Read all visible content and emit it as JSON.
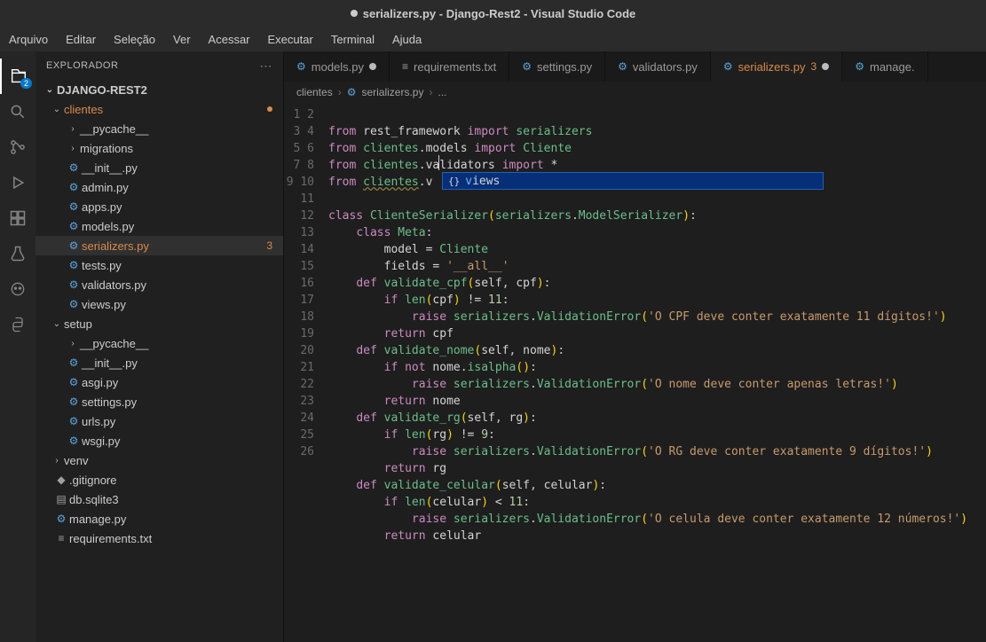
{
  "window": {
    "title": "serializers.py - Django-Rest2 - Visual Studio Code"
  },
  "menu": [
    "Arquivo",
    "Editar",
    "Seleção",
    "Ver",
    "Acessar",
    "Executar",
    "Terminal",
    "Ajuda"
  ],
  "activity": {
    "badge": "2"
  },
  "sidebar": {
    "title": "EXPLORADOR",
    "root": "DJANGO-REST2",
    "clientes": {
      "label": "clientes",
      "badge": "3",
      "children": {
        "pycache": "__pycache__",
        "migrations": "migrations",
        "init": "__init__.py",
        "admin": "admin.py",
        "apps": "apps.py",
        "models": "models.py",
        "serializers": "serializers.py",
        "tests": "tests.py",
        "validators": "validators.py",
        "views": "views.py"
      }
    },
    "setup": {
      "label": "setup",
      "children": {
        "pycache": "__pycache__",
        "init": "__init__.py",
        "asgi": "asgi.py",
        "settings": "settings.py",
        "urls": "urls.py",
        "wsgi": "wsgi.py"
      }
    },
    "venv": "venv",
    "gitignore": ".gitignore",
    "db": "db.sqlite3",
    "manage": "manage.py",
    "reqs": "requirements.txt"
  },
  "tabs": {
    "models": "models.py",
    "reqs": "requirements.txt",
    "settings": "settings.py",
    "validators": "validators.py",
    "serializers": "serializers.py",
    "serializers_badge": "3",
    "manage": "manage."
  },
  "crumbs": {
    "a": "clientes",
    "b": "serializers.py",
    "c": "..."
  },
  "suggest": {
    "icon": "{}",
    "match": "v",
    "rest": "iews"
  },
  "code": {
    "l1": {
      "from": "from",
      "rest": "rest_framework",
      "import": "import",
      "serializers": "serializers"
    },
    "l2": {
      "from": "from",
      "clientes": "clientes",
      "models": "models",
      "import": "import",
      "Cliente": "Cliente"
    },
    "l3": {
      "from": "from",
      "clientes": "clientes",
      "validators": "validators",
      "import": "import",
      "star": "*"
    },
    "l4": {
      "from": "from",
      "clientes": "clientes",
      "v": "v"
    },
    "l6": {
      "class": "class",
      "name": "ClienteSerializer",
      "ser": "serializers",
      "ms": "ModelSerializer"
    },
    "l7": {
      "class": "class",
      "Meta": "Meta"
    },
    "l8": {
      "model": "model",
      "eq": "=",
      "Cliente": "Cliente"
    },
    "l9": {
      "fields": "fields",
      "eq": "=",
      "all": "'__all__'"
    },
    "l10": {
      "def": "def",
      "name": "validate_cpf",
      "self": "self",
      "arg": "cpf"
    },
    "l11": {
      "if": "if",
      "len": "len",
      "arg": "cpf",
      "ne": "!=",
      "num": "11"
    },
    "l12": {
      "raise": "raise",
      "ser": "serializers",
      "ve": "ValidationError",
      "msg": "'O CPF deve conter exatamente 11 dígitos!'"
    },
    "l13": {
      "return": "return",
      "arg": "cpf"
    },
    "l14": {
      "def": "def",
      "name": "validate_nome",
      "self": "self",
      "arg": "nome"
    },
    "l15": {
      "if": "if",
      "not": "not",
      "arg": "nome",
      "isalpha": "isalpha"
    },
    "l16": {
      "raise": "raise",
      "ser": "serializers",
      "ve": "ValidationError",
      "msg": "'O nome deve conter apenas letras!'"
    },
    "l17": {
      "return": "return",
      "arg": "nome"
    },
    "l18": {
      "def": "def",
      "name": "validate_rg",
      "self": "self",
      "arg": "rg"
    },
    "l19": {
      "if": "if",
      "len": "len",
      "arg": "rg",
      "ne": "!=",
      "num": "9"
    },
    "l20": {
      "raise": "raise",
      "ser": "serializers",
      "ve": "ValidationError",
      "msg": "'O RG deve conter exatamente 9 dígitos!'"
    },
    "l21": {
      "return": "return",
      "arg": "rg"
    },
    "l22": {
      "def": "def",
      "name": "validate_celular",
      "self": "self",
      "arg": "celular"
    },
    "l23": {
      "if": "if",
      "len": "len",
      "arg": "celular",
      "lt": "<",
      "num": "11"
    },
    "l24": {
      "raise": "raise",
      "ser": "serializers",
      "ve": "ValidationError",
      "msg": "'O celula deve conter exatamente 12 números!'"
    },
    "l25": {
      "return": "return",
      "arg": "celular"
    }
  }
}
